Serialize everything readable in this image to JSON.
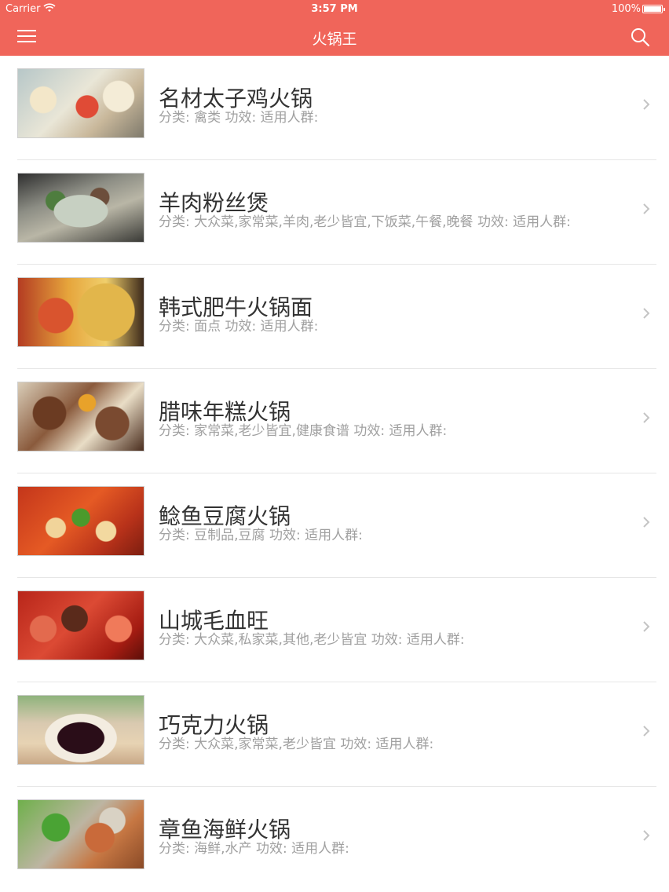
{
  "status_bar": {
    "carrier": "Carrier",
    "time": "3:57 PM",
    "battery": "100%"
  },
  "navbar": {
    "title": "火锅王",
    "menu_icon": "menu-icon",
    "search_icon": "search-icon"
  },
  "colors": {
    "accent": "#f0655a",
    "title_text": "#333333",
    "meta_text": "#a0a0a0"
  },
  "recipes": [
    {
      "title": "名材太子鸡火锅",
      "meta": "分类: 禽类   功效:    适用人群:"
    },
    {
      "title": "羊肉粉丝煲",
      "meta": "分类: 大众菜,家常菜,羊肉,老少皆宜,下饭菜,午餐,晚餐   功效:    适用人群:"
    },
    {
      "title": "韩式肥牛火锅面",
      "meta": "分类: 面点   功效:    适用人群:"
    },
    {
      "title": "腊味年糕火锅",
      "meta": "分类: 家常菜,老少皆宜,健康食谱   功效:    适用人群:"
    },
    {
      "title": "鲶鱼豆腐火锅",
      "meta": "分类: 豆制品,豆腐   功效:    适用人群:"
    },
    {
      "title": "山城毛血旺",
      "meta": "分类: 大众菜,私家菜,其他,老少皆宜   功效:    适用人群:"
    },
    {
      "title": "巧克力火锅",
      "meta": "分类: 大众菜,家常菜,老少皆宜   功效:    适用人群:"
    },
    {
      "title": "章鱼海鲜火锅",
      "meta": "分类: 海鲜,水产   功效:    适用人群:"
    }
  ]
}
